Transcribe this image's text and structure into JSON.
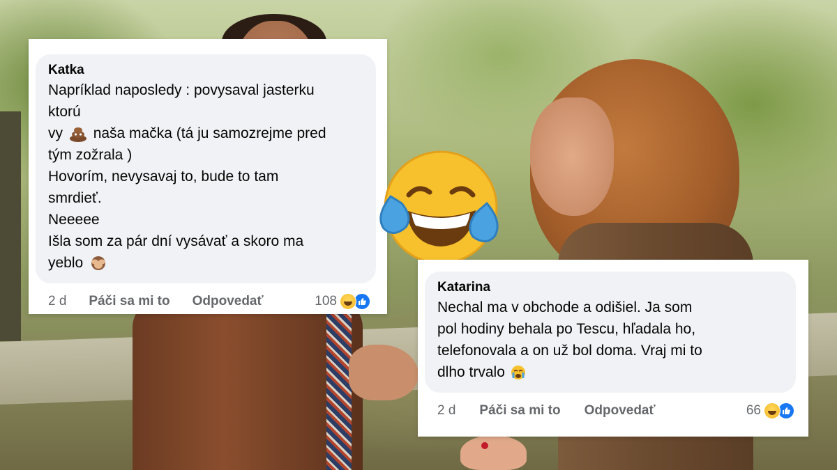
{
  "comments": [
    {
      "author": "Katka",
      "lines": [
        "Napríklad naposledy : povysaval jasterku",
        "ktorú",
        "vy",
        "naša mačka (tá ju samozrejme pred",
        "tým zožrala )",
        "Hovorím, nevysavaj to, bude to tam",
        "smrdieť.",
        "Neeeee",
        "Išla som za pár dní vysávať a skoro ma",
        "yeblo"
      ],
      "inline_emojis": [
        "pile-of-poo-icon",
        "see-no-evil-monkey-icon"
      ],
      "time": "2 d",
      "like_label": "Páči sa mi to",
      "reply_label": "Odpovedať",
      "reaction_count": "108"
    },
    {
      "author": "Katarina",
      "lines": [
        "Nechal ma v obchode a odišiel. Ja som",
        "pol hodiny behala po Tescu, hľadala ho,",
        "telefonovala a on už bol doma. Vraj mi to",
        "dlho trvalo"
      ],
      "inline_emojis": [
        "crying-face-icon"
      ],
      "time": "2 d",
      "like_label": "Páči sa mi to",
      "reply_label": "Odpovedať",
      "reaction_count": "66"
    }
  ],
  "overlay_emoji": "face-with-tears-of-joy-icon",
  "colors": {
    "bubble": "#f0f2f5",
    "meta_text": "#65676b",
    "like_blue": "#1877f2",
    "emoji_yellow": "#f7c02d"
  }
}
